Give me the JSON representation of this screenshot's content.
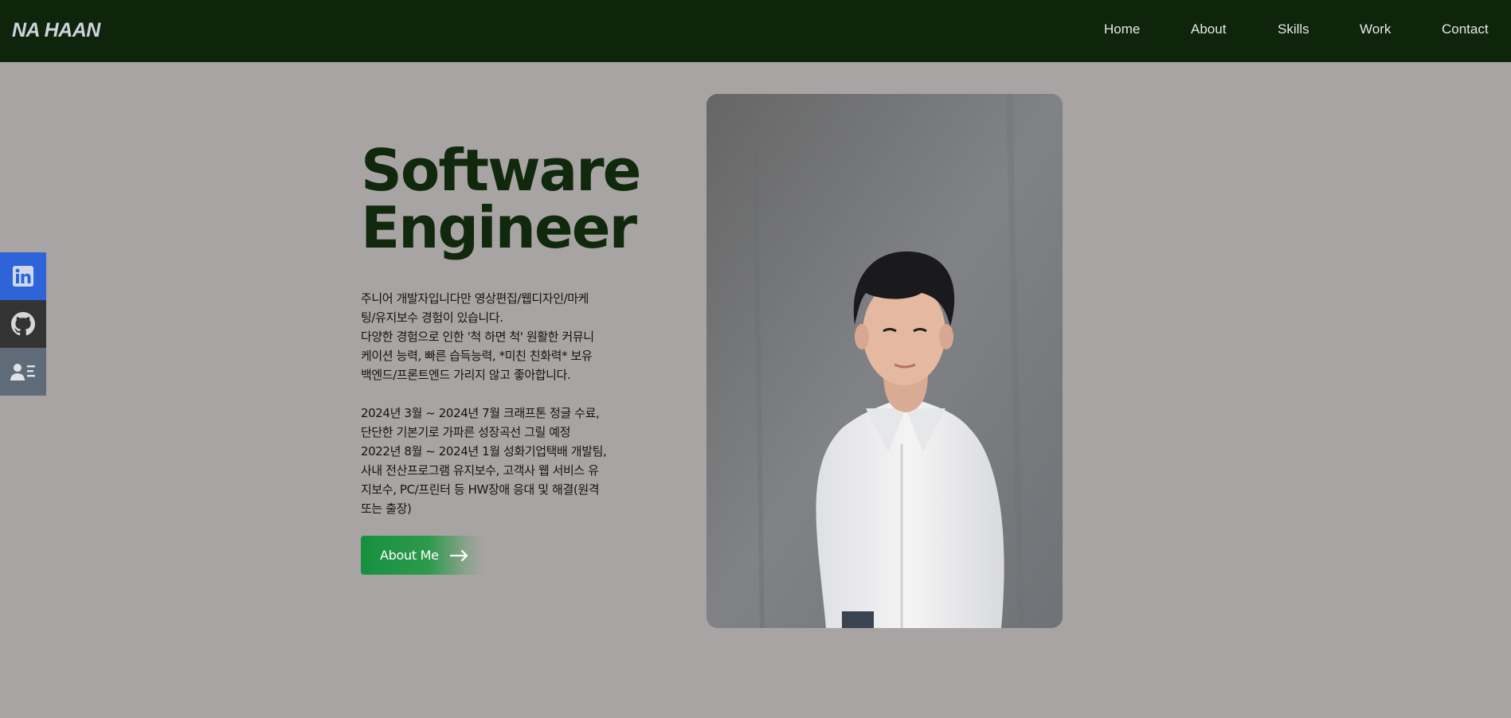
{
  "header": {
    "logo": "NA HAAN",
    "nav": [
      "Home",
      "About",
      "Skills",
      "Work",
      "Contact"
    ]
  },
  "social": {
    "items": [
      {
        "name": "linkedin",
        "icon": "linkedin-icon",
        "color": "#2e64d8"
      },
      {
        "name": "github",
        "icon": "github-icon",
        "color": "#333333"
      },
      {
        "name": "profile",
        "icon": "contact-card-icon",
        "color": "#5f6b79"
      }
    ]
  },
  "hero": {
    "title_line1": "Software",
    "title_line2": "Engineer",
    "paragraph1": "주니어 개발자입니다만 영상편집/웹디자인/마케\n팅/유지보수 경험이 있습니다.\n다양한 경험으로 인한 '척 하면 척' 원활한 커뮤니\n케이션 능력, 빠른 습득능력, *미친 친화력* 보유\n백엔드/프론트엔드 가리지 않고 좋아합니다.",
    "paragraph2": "2024년 3월 ~ 2024년 7월 크래프톤 정글 수료,\n단단한 기본기로 가파른 성장곡선 그릴 예정\n2022년 8월 ~ 2024년 1월 성화기업택배 개발팀,\n사내 전산프로그램 유지보수, 고객사 웹 서비스 유\n지보수, PC/프린터 등 HW장애 응대 및 해결(원격\n또는 출장)",
    "button_label": "About Me"
  },
  "colors": {
    "navbar_bg": "#0e240b",
    "page_bg": "#a8a4a3",
    "title": "#10290c",
    "button": "#179040"
  }
}
